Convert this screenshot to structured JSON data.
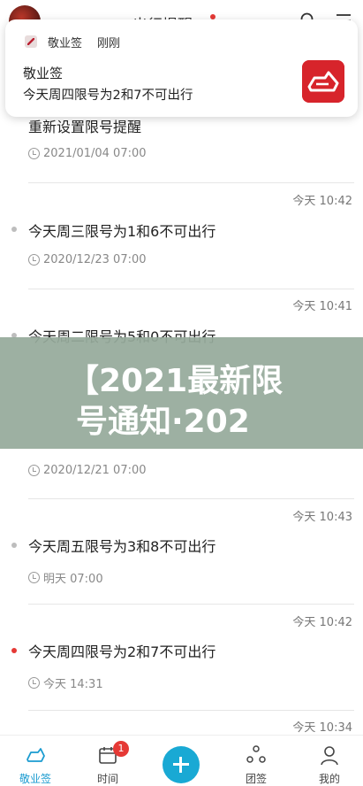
{
  "topbar": {
    "title": "出行提醒"
  },
  "notification": {
    "app_name": "敬业签",
    "time": "刚刚",
    "title": "敬业签",
    "body": "今天周四限号为2和7不可出行"
  },
  "feed": {
    "first_item": {
      "title": "重新设置限号提醒",
      "reminder": "2021/01/04 07:00"
    },
    "items": [
      {
        "stamp": "今天 10:42",
        "title": "今天周三限号为1和6不可出行",
        "reminder": "2020/12/23 07:00",
        "unread": false
      },
      {
        "stamp": "今天 10:41",
        "title": "今天周二限号为5和0不可出行",
        "reminder": "",
        "unread": false
      },
      {
        "stamp": "",
        "title": "",
        "reminder": "2020/12/21 07:00",
        "unread": false
      },
      {
        "stamp": "今天 10:43",
        "title": "今天周五限号为3和8不可出行",
        "reminder": "明天 07:00",
        "unread": false
      },
      {
        "stamp": "今天 10:42",
        "title": "今天周四限号为2和7不可出行",
        "reminder": "今天 14:31",
        "unread": true
      },
      {
        "stamp": "今天 10:34",
        "title": "",
        "reminder": "",
        "unread": false
      }
    ]
  },
  "banner": {
    "line1": "【2021最新限",
    "line2": "号通知·202"
  },
  "bottom_nav": {
    "items": [
      {
        "label": "敬业签",
        "icon": "note-icon",
        "active": true
      },
      {
        "label": "时间",
        "icon": "calendar-icon",
        "badge": "1"
      },
      {
        "label": "",
        "icon": "add-icon"
      },
      {
        "label": "团签",
        "icon": "team-icon"
      },
      {
        "label": "我的",
        "icon": "profile-icon"
      }
    ]
  },
  "colors": {
    "accent": "#1a9bd0",
    "unread": "#e53935",
    "brand_red": "#d7242b"
  }
}
